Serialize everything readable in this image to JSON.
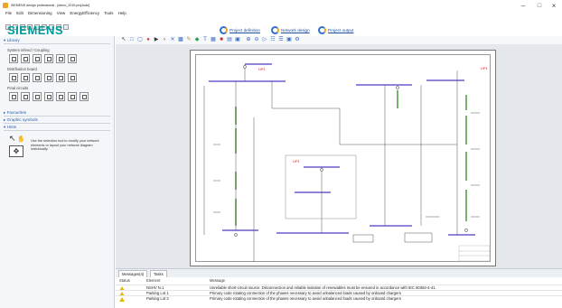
{
  "window": {
    "title": "SIEMENS design professional - [demo_2019.proj1sde]",
    "controls": [
      "–",
      "□",
      "×"
    ]
  },
  "menu": [
    "File",
    "Edit",
    "Dimensioning",
    "View",
    "EnergyEfficiency",
    "Tools",
    "Help"
  ],
  "logo": "SIEMENS",
  "workflow": {
    "tabs": [
      {
        "label": "Project definition"
      },
      {
        "label": "Network design"
      },
      {
        "label": "Project output"
      }
    ]
  },
  "library": {
    "header": "Library",
    "groups": [
      {
        "label": "System infeed / Coupling",
        "count": 6
      },
      {
        "label": "Distribution board",
        "count": 6
      },
      {
        "label": "Final circuits",
        "count": 7
      }
    ],
    "favourites": "Favourites",
    "graphic_symbols": "Graphic symbols",
    "hints": "Hints",
    "hint_text": "Use the selection tool to modify your network elements or layout your network diagram individually."
  },
  "diagram": {
    "labels": [
      "UP1",
      "UP1",
      "UP1"
    ],
    "colors": {
      "busbar": "#6a5acd",
      "cable": "#57a04a",
      "frame": "#777777",
      "label_red": "#cc2222"
    }
  },
  "messages": {
    "tabs": [
      "Messages(4)",
      "Tasks"
    ],
    "columns": [
      "Status",
      "Element",
      "Message"
    ],
    "rows": [
      {
        "element": "NSHV N.1",
        "text": "Unreliable short-circuit source: Disconnection and reliable isolation of renewables must be ensured in accordance with IEC 60364-4-41."
      },
      {
        "element": "Parking Lot 1",
        "text": "Primary code rotating connection of the phases necessary to avoid unbalanced loads caused by onboard chargers"
      },
      {
        "element": "Parking Lot 2",
        "text": "Primary code rotating connection of the phases necessary to avoid unbalanced loads caused by onboard chargers"
      }
    ]
  }
}
